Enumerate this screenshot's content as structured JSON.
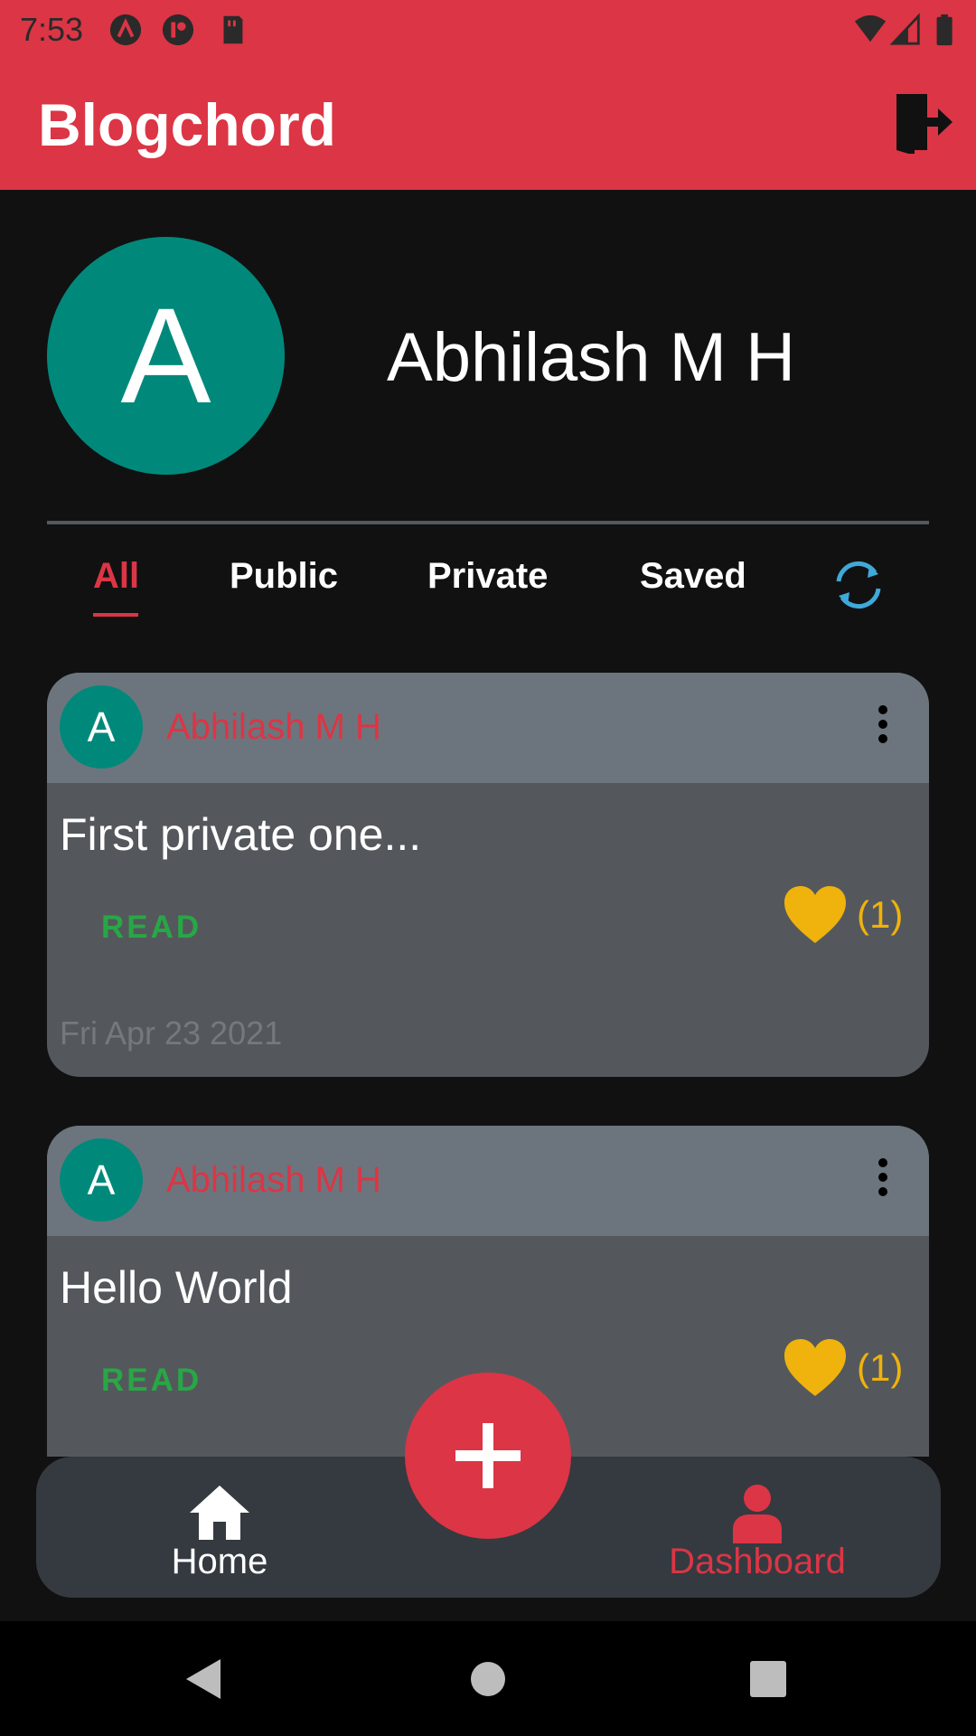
{
  "status_bar": {
    "time": "7:53"
  },
  "app_bar": {
    "title": "Blogchord"
  },
  "profile": {
    "initial": "A",
    "name": "Abhilash M H"
  },
  "tabs": [
    {
      "label": "All",
      "active": true
    },
    {
      "label": "Public",
      "active": false
    },
    {
      "label": "Private",
      "active": false
    },
    {
      "label": "Saved",
      "active": false
    }
  ],
  "posts": [
    {
      "author_initial": "A",
      "author": "Abhilash M H",
      "title": "First private one...",
      "read_label": "READ",
      "likes": "(1)",
      "date": "Fri Apr 23 2021"
    },
    {
      "author_initial": "A",
      "author": "Abhilash M H",
      "title": "Hello World",
      "read_label": "READ",
      "likes": "(1)"
    }
  ],
  "bottom_nav": {
    "home_label": "Home",
    "dashboard_label": "Dashboard"
  },
  "colors": {
    "primary": "#dc3545",
    "avatar": "#00897b",
    "read": "#28a745",
    "like": "#f0b20c",
    "refresh": "#3fa9d9"
  }
}
